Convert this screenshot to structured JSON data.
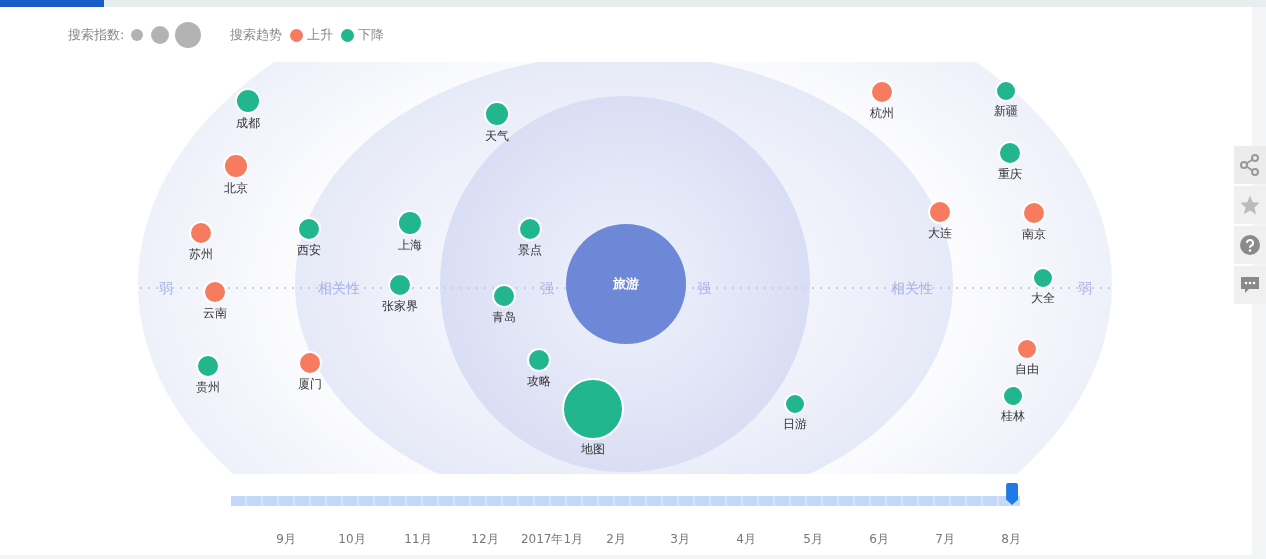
{
  "legend": {
    "index_label": "搜索指数:",
    "trend_label": "搜索趋势",
    "trends": [
      {
        "label": "上升",
        "color": "#f77b5f"
      },
      {
        "label": "下降",
        "color": "#22b68e"
      }
    ]
  },
  "center": {
    "label": "旅游"
  },
  "axis_labels": [
    "弱",
    "相关性",
    "强",
    "强",
    "相关性",
    "弱"
  ],
  "nodes": [
    {
      "label": "成都",
      "color": "#22b68e"
    },
    {
      "label": "北京",
      "color": "#f77b5f"
    },
    {
      "label": "苏州",
      "color": "#f77b5f"
    },
    {
      "label": "云南",
      "color": "#f77b5f"
    },
    {
      "label": "贵州",
      "color": "#22b68e"
    },
    {
      "label": "西安",
      "color": "#22b68e"
    },
    {
      "label": "厦门",
      "color": "#f77b5f"
    },
    {
      "label": "上海",
      "color": "#22b68e"
    },
    {
      "label": "张家界",
      "color": "#22b68e"
    },
    {
      "label": "天气",
      "color": "#22b68e"
    },
    {
      "label": "景点",
      "color": "#22b68e"
    },
    {
      "label": "青岛",
      "color": "#22b68e"
    },
    {
      "label": "攻略",
      "color": "#22b68e"
    },
    {
      "label": "地图",
      "color": "#22b68e"
    },
    {
      "label": "日游",
      "color": "#22b68e"
    },
    {
      "label": "杭州",
      "color": "#f77b5f"
    },
    {
      "label": "大连",
      "color": "#f77b5f"
    },
    {
      "label": "新疆",
      "color": "#22b68e"
    },
    {
      "label": "重庆",
      "color": "#22b68e"
    },
    {
      "label": "南京",
      "color": "#f77b5f"
    },
    {
      "label": "大全",
      "color": "#22b68e"
    },
    {
      "label": "自由",
      "color": "#f77b5f"
    },
    {
      "label": "桂林",
      "color": "#22b68e"
    }
  ],
  "timeline": {
    "level": 0.99,
    "months": [
      "9月",
      "10月",
      "11月",
      "12月",
      "2017年1月",
      "2月",
      "3月",
      "4月",
      "5月",
      "6月",
      "7月",
      "8月"
    ]
  }
}
